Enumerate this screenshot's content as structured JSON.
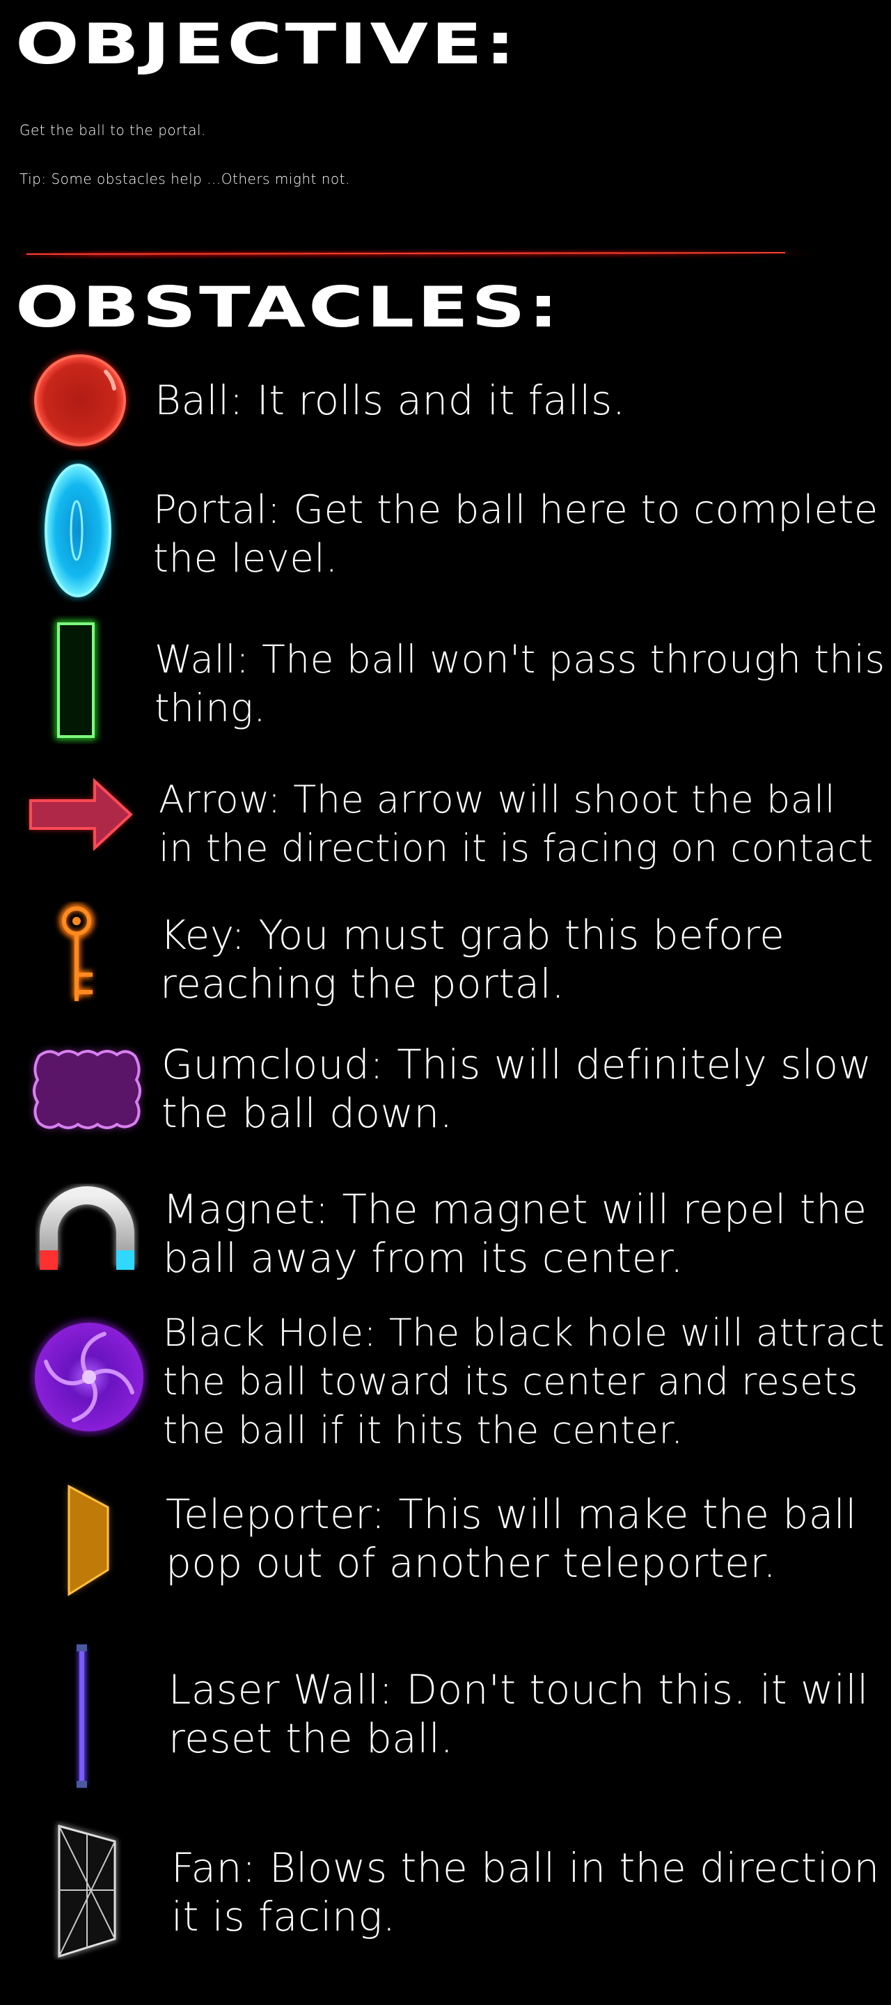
{
  "objective": {
    "heading": "OBJECTIVE:",
    "line1": "Get the ball to the portal.",
    "line2": "Tip: Some obstacles help ...Others might not."
  },
  "obstacles_heading": "OBSTACLES:",
  "obstacles": [
    {
      "icon": "ball-icon",
      "lines": [
        "Ball: It rolls and it falls."
      ]
    },
    {
      "icon": "portal-icon",
      "lines": [
        "Portal: Get the ball here to complete",
        "the level."
      ]
    },
    {
      "icon": "wall-icon",
      "lines": [
        "Wall: The ball won't pass through this",
        "thing."
      ]
    },
    {
      "icon": "arrow-icon",
      "lines": [
        "Arrow: The arrow will shoot the ball",
        "in the direction it is facing on contact"
      ]
    },
    {
      "icon": "key-icon",
      "lines": [
        "Key: You must grab this before",
        "reaching the portal."
      ]
    },
    {
      "icon": "gumcloud-icon",
      "lines": [
        "Gumcloud: This will definitely slow",
        "the ball down."
      ]
    },
    {
      "icon": "magnet-icon",
      "lines": [
        "Magnet: The magnet will repel the",
        "ball away from its center."
      ]
    },
    {
      "icon": "black-hole-icon",
      "lines": [
        "Black Hole: The black hole will attract",
        "the ball toward its center and resets",
        "the ball if it hits the center."
      ]
    },
    {
      "icon": "teleporter-icon",
      "lines": [
        "Teleporter: This will make the ball",
        "pop out of another teleporter."
      ]
    },
    {
      "icon": "laser-wall-icon",
      "lines": [
        "Laser Wall: Don't touch this. it will",
        "reset the ball."
      ]
    },
    {
      "icon": "fan-icon",
      "lines": [
        "Fan: Blows the ball in the direction",
        "it is facing."
      ]
    }
  ],
  "colors": {
    "background": "#000000",
    "text": "#ffffff",
    "divider": "#e01010",
    "ball": "#e0281c",
    "portal": "#19d4ff",
    "wall": "#2fe82f",
    "arrow": "#e0283c",
    "key": "#ff7a10",
    "gumcloud": "#b040d0",
    "magnet_body": "#c8c8c8",
    "magnet_red": "#ff3030",
    "magnet_cyan": "#30d8ff",
    "black_hole": "#8a1fd8",
    "teleporter": "#e8a010",
    "laser": "#6a40ff",
    "fan": "#d8d8d8"
  }
}
